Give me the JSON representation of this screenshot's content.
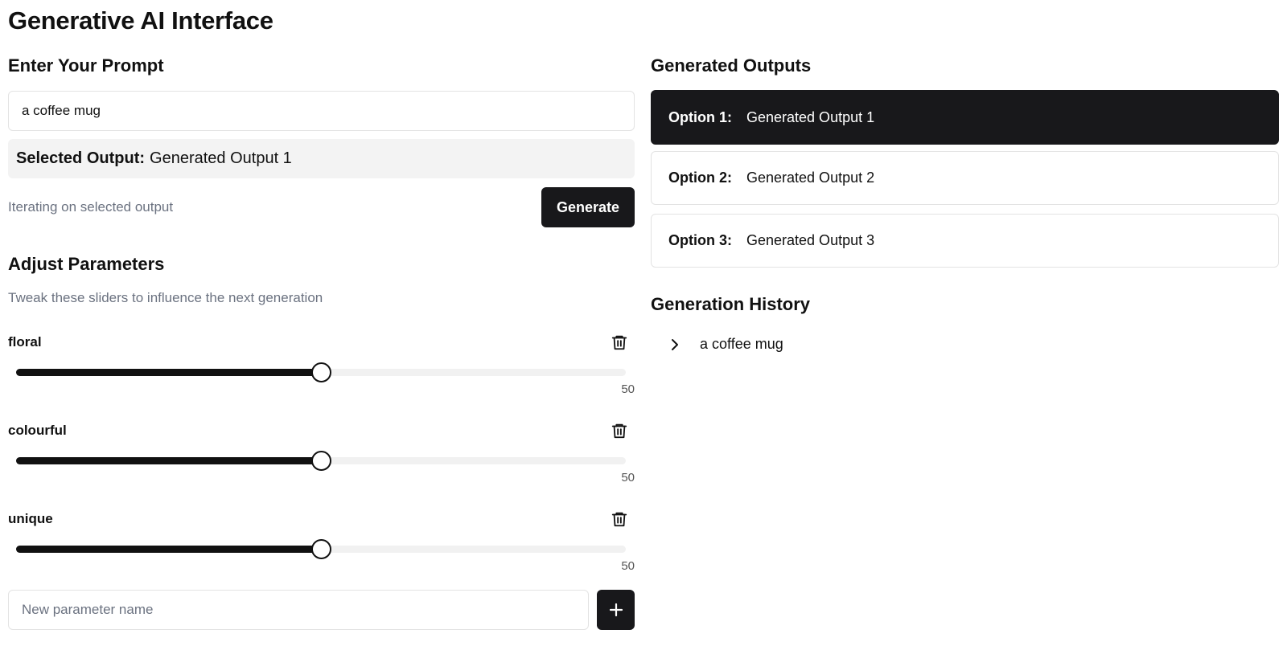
{
  "app": {
    "title": "Generative AI Interface"
  },
  "prompt": {
    "heading": "Enter Your Prompt",
    "value": "a coffee mug"
  },
  "selected": {
    "label": "Selected Output:",
    "value": "Generated Output 1"
  },
  "status": {
    "iterating_text": "Iterating on selected output"
  },
  "generate": {
    "label": "Generate"
  },
  "params": {
    "heading": "Adjust Parameters",
    "subtitle": "Tweak these sliders to influence the next generation",
    "items": [
      {
        "name": "floral",
        "value": 50,
        "value_text": "50",
        "min": 0,
        "max": 100
      },
      {
        "name": "colourful",
        "value": 50,
        "value_text": "50",
        "min": 0,
        "max": 100
      },
      {
        "name": "unique",
        "value": 50,
        "value_text": "50",
        "min": 0,
        "max": 100
      }
    ],
    "new_param": {
      "placeholder": "New parameter name",
      "value": ""
    },
    "add_icon": "plus-icon",
    "delete_icon": "trash-icon"
  },
  "outputs": {
    "heading": "Generated Outputs",
    "items": [
      {
        "label": "Option 1:",
        "text": "Generated Output 1",
        "selected": true
      },
      {
        "label": "Option 2:",
        "text": "Generated Output 2",
        "selected": false
      },
      {
        "label": "Option 3:",
        "text": "Generated Output 3",
        "selected": false
      }
    ]
  },
  "history": {
    "heading": "Generation History",
    "items": [
      {
        "text": "a coffee mug",
        "icon": "chevron-right-icon"
      }
    ]
  },
  "colors": {
    "primary": "#18181b",
    "muted_text": "#6b7280",
    "selected_bg": "#f3f3f3",
    "border": "#e3e3e3",
    "track": "#f1f1f1"
  }
}
